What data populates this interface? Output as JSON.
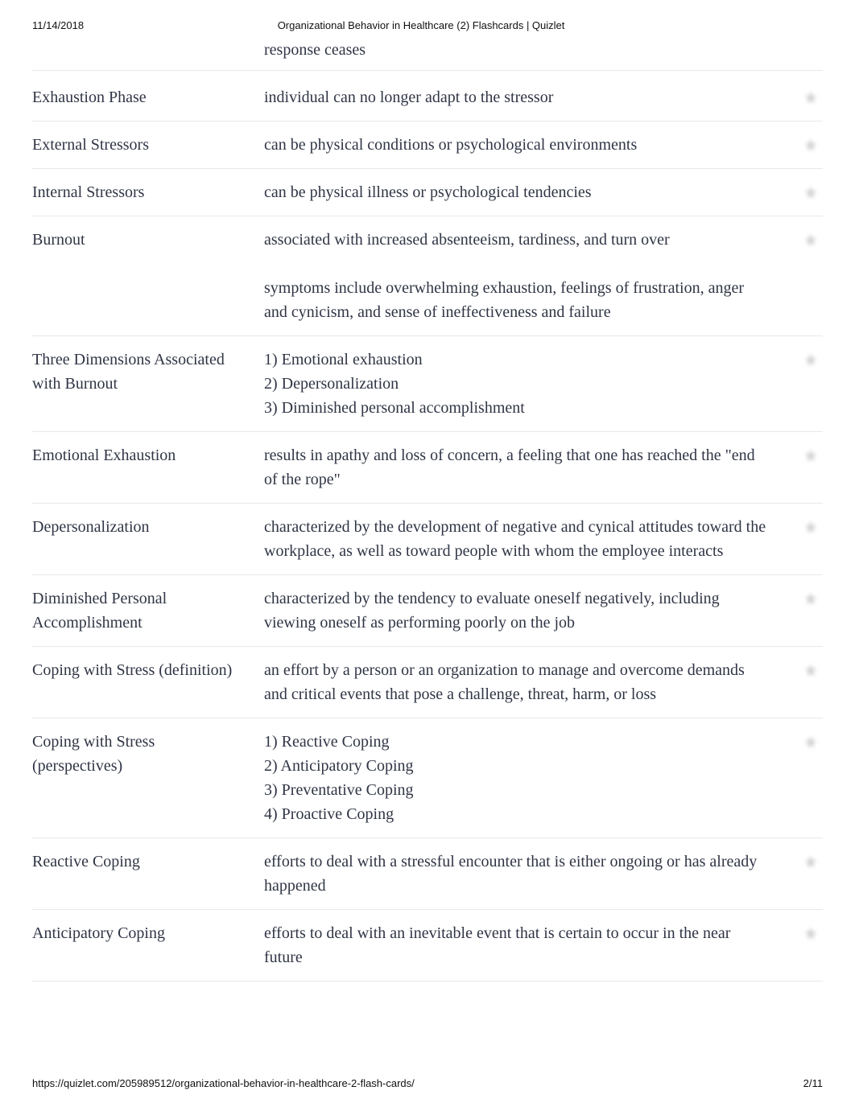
{
  "header": {
    "date": "11/14/2018",
    "title": "Organizational Behavior in Healthcare (2) Flashcards | Quizlet"
  },
  "partial_definition": "response ceases",
  "cards": [
    {
      "term": "Exhaustion Phase",
      "definition": "individual can no longer adapt to the stressor"
    },
    {
      "term": "External Stressors",
      "definition": "can be physical conditions or psychological environments"
    },
    {
      "term": "Internal Stressors",
      "definition": "can be physical illness or psychological tendencies"
    },
    {
      "term": "Burnout",
      "definition": "associated with increased absenteeism, tardiness, and turn over\n\nsymptoms include overwhelming exhaustion, feelings of frustration, anger and cynicism, and sense of ineffectiveness and failure"
    },
    {
      "term": "Three Dimensions Associated with Burnout",
      "definition": "1) Emotional exhaustion\n2) Depersonalization\n3) Diminished personal accomplishment"
    },
    {
      "term": "Emotional Exhaustion",
      "definition": "results in apathy and loss of concern, a feeling that one has reached the \"end of the rope\""
    },
    {
      "term": "Depersonalization",
      "definition": "characterized by the development of negative and cynical attitudes toward the workplace, as well as toward people with whom the employee interacts"
    },
    {
      "term": "Diminished Personal Accomplishment",
      "definition": "characterized by the tendency to evaluate oneself negatively, including viewing oneself as performing poorly on the job"
    },
    {
      "term": "Coping with Stress (definition)",
      "definition": "an effort by a person or an organization to manage and overcome demands and critical events that pose a challenge, threat, harm, or loss"
    },
    {
      "term": "Coping with Stress (perspectives)",
      "definition": "1) Reactive Coping\n2) Anticipatory Coping\n3) Preventative Coping\n4) Proactive Coping"
    },
    {
      "term": "Reactive Coping",
      "definition": "efforts to deal with a stressful encounter that is either ongoing or has already happened"
    },
    {
      "term": "Anticipatory Coping",
      "definition": "efforts to deal with an inevitable event that is certain to occur in the near future"
    }
  ],
  "footer": {
    "url": "https://quizlet.com/205989512/organizational-behavior-in-healthcare-2-flash-cards/",
    "page": "2/11"
  }
}
